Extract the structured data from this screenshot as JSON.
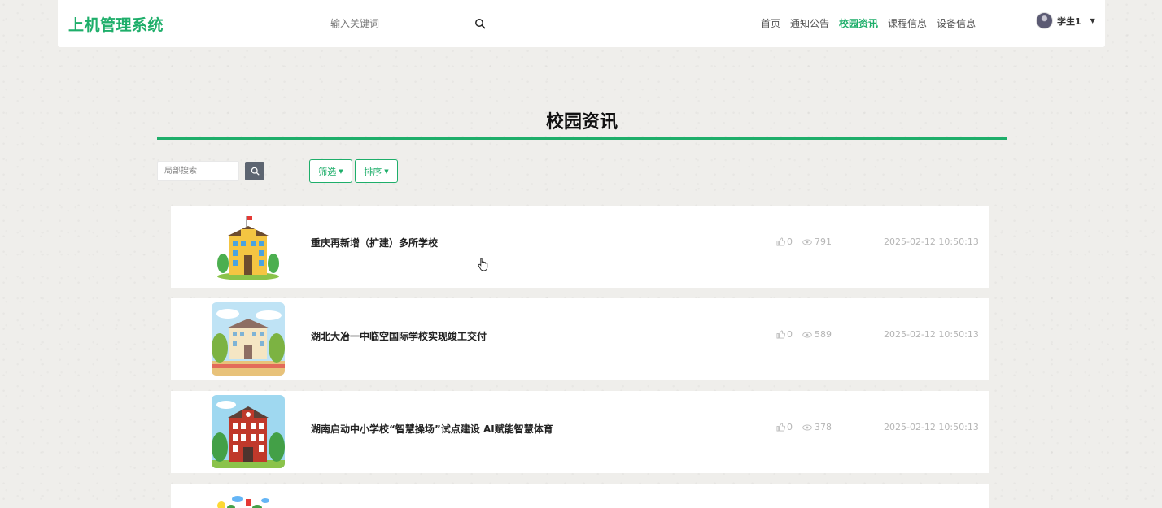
{
  "header": {
    "logo": "上机管理系统",
    "search_placeholder": "输入关键词",
    "nav": [
      "首页",
      "通知公告",
      "校园资讯",
      "课程信息",
      "设备信息"
    ],
    "active_nav": "校园资讯",
    "user": "学生1"
  },
  "page": {
    "title": "校园资讯",
    "local_search_placeholder": "局部搜索",
    "filter_label": "筛选",
    "sort_label": "排序"
  },
  "news": [
    {
      "title": "重庆再新增（扩建）多所学校",
      "likes": "0",
      "views": "791",
      "date": "2025-02-12 10:50:13"
    },
    {
      "title": "湖北大冶一中临空国际学校实现竣工交付",
      "likes": "0",
      "views": "589",
      "date": "2025-02-12 10:50:13"
    },
    {
      "title": "湖南启动中小学校“智慧操场”试点建设 AI赋能智慧体育",
      "likes": "0",
      "views": "378",
      "date": "2025-02-12 10:50:13"
    }
  ],
  "colors": {
    "accent": "#1eae6a",
    "search_button": "#5d6571",
    "meta_text": "#b5b5b5"
  },
  "icons": [
    "search-icon",
    "like-icon",
    "eye-icon",
    "chevron-down-icon",
    "school-building-icon",
    "hand-cursor-icon"
  ]
}
